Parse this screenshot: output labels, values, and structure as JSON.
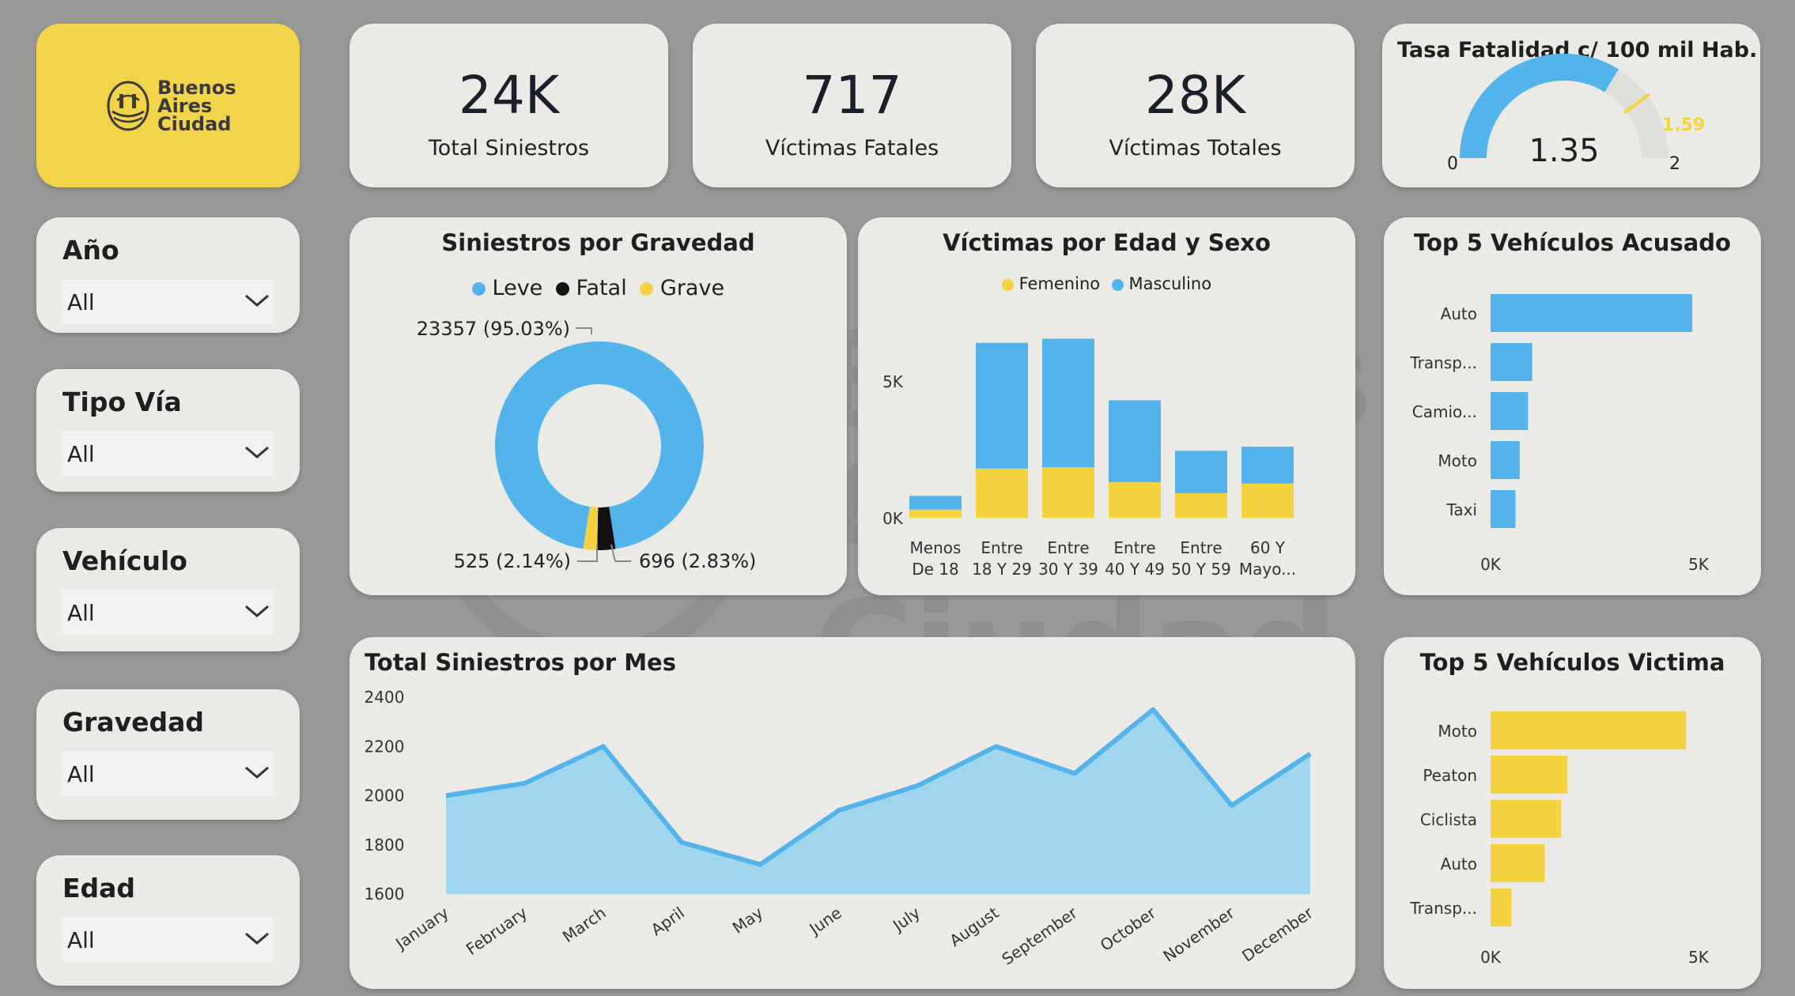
{
  "colors": {
    "blue": "#53b4ec",
    "yellow": "#f5d33f",
    "black": "#111111",
    "card": "#ebeae7",
    "background": "#989898"
  },
  "logo": {
    "line1": "Buenos",
    "line2": "Aires",
    "line3": "Ciudad"
  },
  "kpis": [
    {
      "value": "24K",
      "label": "Total Siniestros"
    },
    {
      "value": "717",
      "label": "Víctimas Fatales"
    },
    {
      "value": "28K",
      "label": "Víctimas Totales"
    }
  ],
  "gauge": {
    "title": "Tasa Fatalidad c/ 100 mil Hab.",
    "value": 1.35,
    "value_label": "1.35",
    "min": 0,
    "min_label": "0",
    "max": 2,
    "max_label": "2",
    "target": 1.59,
    "target_label": "1.59"
  },
  "slicers": [
    {
      "title": "Año",
      "value": "All"
    },
    {
      "title": "Tipo Vía",
      "value": "All"
    },
    {
      "title": "Vehículo",
      "value": "All"
    },
    {
      "title": "Gravedad",
      "value": "All"
    },
    {
      "title": "Edad",
      "value": "All"
    }
  ],
  "chart_data": [
    {
      "id": "gravedad",
      "type": "pie",
      "title": "Siniestros por Gravedad",
      "legend": [
        "Leve",
        "Fatal",
        "Grave"
      ],
      "legend_position": "top",
      "slices": [
        {
          "name": "Leve",
          "value": 23357,
          "label": "23357 (95.03%)",
          "color": "#53b4ec"
        },
        {
          "name": "Fatal",
          "value": 696,
          "label": "696 (2.83%)",
          "color": "#111111"
        },
        {
          "name": "Grave",
          "value": 525,
          "label": "525 (2.14%)",
          "color": "#f5d33f"
        }
      ]
    },
    {
      "id": "edad_sexo",
      "type": "bar",
      "stacked": true,
      "title": "Víctimas por Edad y Sexo",
      "legend": [
        "Femenino",
        "Masculino"
      ],
      "legend_position": "top",
      "categories": [
        [
          "Menos",
          "De 18"
        ],
        [
          "Entre",
          "18 Y 29"
        ],
        [
          "Entre",
          "30 Y 39"
        ],
        [
          "Entre",
          "40 Y 49"
        ],
        [
          "Entre",
          "50 Y 59"
        ],
        [
          "60 Y",
          "Mayo..."
        ]
      ],
      "series": [
        {
          "name": "Femenino",
          "color": "#f5d33f",
          "values": [
            300,
            1800,
            1850,
            1300,
            900,
            1250
          ]
        },
        {
          "name": "Masculino",
          "color": "#53b4ec",
          "values": [
            500,
            4600,
            4700,
            3000,
            1550,
            1350
          ]
        }
      ],
      "yticks": [
        "0K",
        "5K"
      ],
      "ytick_values": [
        0,
        5000
      ],
      "ylim": [
        0,
        7000
      ],
      "grid": false
    },
    {
      "id": "acusado",
      "type": "bar",
      "orientation": "horizontal",
      "title": "Top 5 Vehículos Acusado",
      "categories": [
        "Auto",
        "Transp...",
        "Camio...",
        "Moto",
        "Taxi"
      ],
      "values": [
        4850,
        1000,
        900,
        700,
        600
      ],
      "color": "#53b4ec",
      "xticks": [
        "0K",
        "5K"
      ],
      "xtick_values": [
        0,
        5000
      ],
      "xlim": [
        0,
        5000
      ]
    },
    {
      "id": "victima",
      "type": "bar",
      "orientation": "horizontal",
      "title": "Top 5 Vehículos Victima",
      "categories": [
        "Moto",
        "Peaton",
        "Ciclista",
        "Auto",
        "Transp..."
      ],
      "values": [
        4700,
        1850,
        1700,
        1300,
        500
      ],
      "color": "#f5d33f",
      "xticks": [
        "0K",
        "5K"
      ],
      "xtick_values": [
        0,
        5000
      ],
      "xlim": [
        0,
        5000
      ]
    },
    {
      "id": "mes",
      "type": "area",
      "title": "Total Siniestros por Mes",
      "categories": [
        "January",
        "February",
        "March",
        "April",
        "May",
        "June",
        "July",
        "August",
        "September",
        "October",
        "November",
        "December"
      ],
      "values": [
        2000,
        2050,
        2200,
        1810,
        1720,
        1940,
        2040,
        2200,
        2090,
        2350,
        1960,
        2170
      ],
      "yticks": [
        1600,
        1800,
        2000,
        2200,
        2400
      ],
      "ylim": [
        1600,
        2400
      ],
      "line_color": "#53b4ec",
      "fill_color": "#9fd6ee"
    }
  ]
}
